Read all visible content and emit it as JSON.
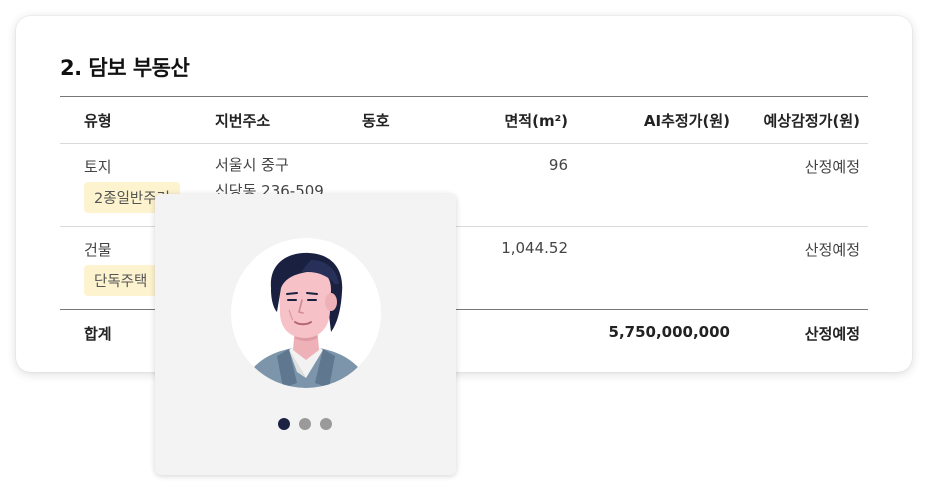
{
  "section": {
    "title": "2. 담보 부동산"
  },
  "table": {
    "headers": {
      "type": "유형",
      "address": "지번주소",
      "unit": "동호",
      "area": "면적(m²)",
      "ai_price": "AI추정가(원)",
      "appraisal": "예상감정가(원)"
    },
    "rows": [
      {
        "type": "토지",
        "badge": "2종일반주거",
        "address_line1": "서울시 중구",
        "address_line2": "신당동 236-509",
        "unit": "",
        "area": "96",
        "ai_price": "",
        "appraisal": "산정예정"
      },
      {
        "type": "건물",
        "badge": "단독주택",
        "address_line1": "",
        "address_line2": "",
        "unit": "",
        "area": "1,044.52",
        "ai_price": "",
        "appraisal": "산정예정"
      }
    ],
    "total": {
      "label": "합계",
      "ai_price": "5,750,000,000",
      "appraisal": "산정예정"
    }
  },
  "popup": {
    "avatar_icon": "person-avatar-icon",
    "carousel": {
      "count": 3,
      "active_index": 0
    }
  },
  "colors": {
    "badge_bg": "#fdf3cf",
    "dot_active": "#1c2342",
    "dot_inactive": "#9a9a9a",
    "popup_bg": "#f3f3f3"
  }
}
